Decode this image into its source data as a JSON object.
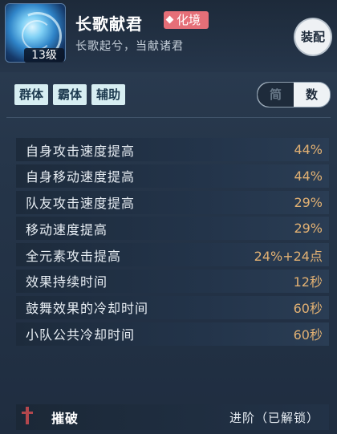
{
  "skill": {
    "name": "长歌献君",
    "tier": "化境",
    "level": "13级",
    "motto": "长歌起兮，当献诸君",
    "equip_label": "装配"
  },
  "tags": [
    "群体",
    "霸体",
    "辅助"
  ],
  "mode_toggle": {
    "simple": "简",
    "detail": "数",
    "selected": "数"
  },
  "stats": [
    {
      "label": "自身攻击速度提高",
      "value": "44%"
    },
    {
      "label": "自身移动速度提高",
      "value": "44%"
    },
    {
      "label": "队友攻击速度提高",
      "value": "29%"
    },
    {
      "label": "移动速度提高",
      "value": "29%"
    },
    {
      "label": "全元素攻击提高",
      "value": "24%+24点"
    },
    {
      "label": "效果持续时间",
      "value": "12秒"
    },
    {
      "label": "鼓舞效果的冷却时间",
      "value": "60秒"
    },
    {
      "label": "小队公共冷却时间",
      "value": "60秒"
    }
  ],
  "footer": {
    "name": "摧破",
    "status": "进阶（已解锁）",
    "icon": "sword-icon"
  },
  "colors": {
    "accent_value": "#e2b173",
    "badge": "#e56f78"
  }
}
